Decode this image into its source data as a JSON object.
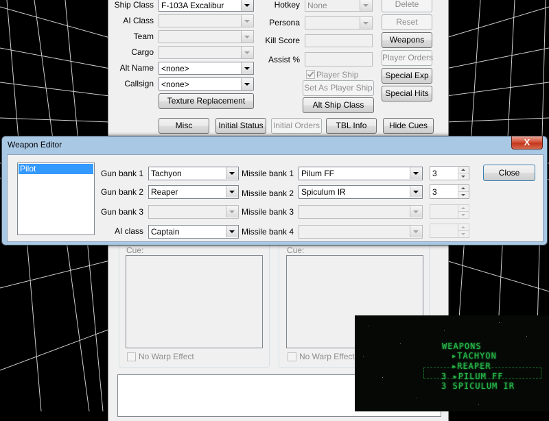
{
  "ship_editor": {
    "labels": {
      "ship_class": "Ship Class",
      "ai_class": "AI Class",
      "team": "Team",
      "cargo": "Cargo",
      "alt_name": "Alt Name",
      "callsign": "Callsign",
      "hotkey": "Hotkey",
      "persona": "Persona",
      "kill_score": "Kill Score",
      "assist": "Assist %",
      "player_ship": "Player Ship",
      "cue": "Cue:",
      "no_warp": "No Warp Effect"
    },
    "values": {
      "ship_class": "F-103A Excalibur",
      "alt_name": "<none>",
      "callsign": "<none>",
      "hotkey": "None"
    },
    "buttons": {
      "delete": "Delete",
      "reset": "Reset",
      "weapons": "Weapons",
      "player_orders": "Player Orders",
      "special_exp": "Special Exp",
      "special_hits": "Special Hits",
      "set_as_player_ship": "Set As Player Ship",
      "alt_ship_class": "Alt Ship Class",
      "texture_replacement": "Texture Replacement",
      "misc": "Misc",
      "initial_status": "Initial Status",
      "initial_orders": "Initial Orders",
      "tbl_info": "TBL Info",
      "hide_cues": "Hide Cues"
    }
  },
  "weapon_editor": {
    "title": "Weapon Editor",
    "close_x": "X",
    "close_button": "Close",
    "list_items": [
      "Pilot"
    ],
    "labels": {
      "gun1": "Gun bank 1",
      "gun2": "Gun bank 2",
      "gun3": "Gun bank 3",
      "ai_class": "AI class",
      "missile1": "Missile bank 1",
      "missile2": "Missile bank 2",
      "missile3": "Missile bank 3",
      "missile4": "Missile bank 4"
    },
    "values": {
      "gun1": "Tachyon",
      "gun2": "Reaper",
      "ai_class": "Captain",
      "missile1": "Pilum FF",
      "missile2": "Spiculum IR",
      "missile1_count": "3",
      "missile2_count": "3"
    }
  },
  "hud": {
    "header": "WEAPONS",
    "guns": [
      "TACHYON",
      "REAPER"
    ],
    "missiles": [
      {
        "count": "3",
        "name": "PILUM FF"
      },
      {
        "count": "3",
        "name": "SPICULUM IR"
      }
    ],
    "colors": {
      "hud_green": "#27b84a"
    }
  }
}
